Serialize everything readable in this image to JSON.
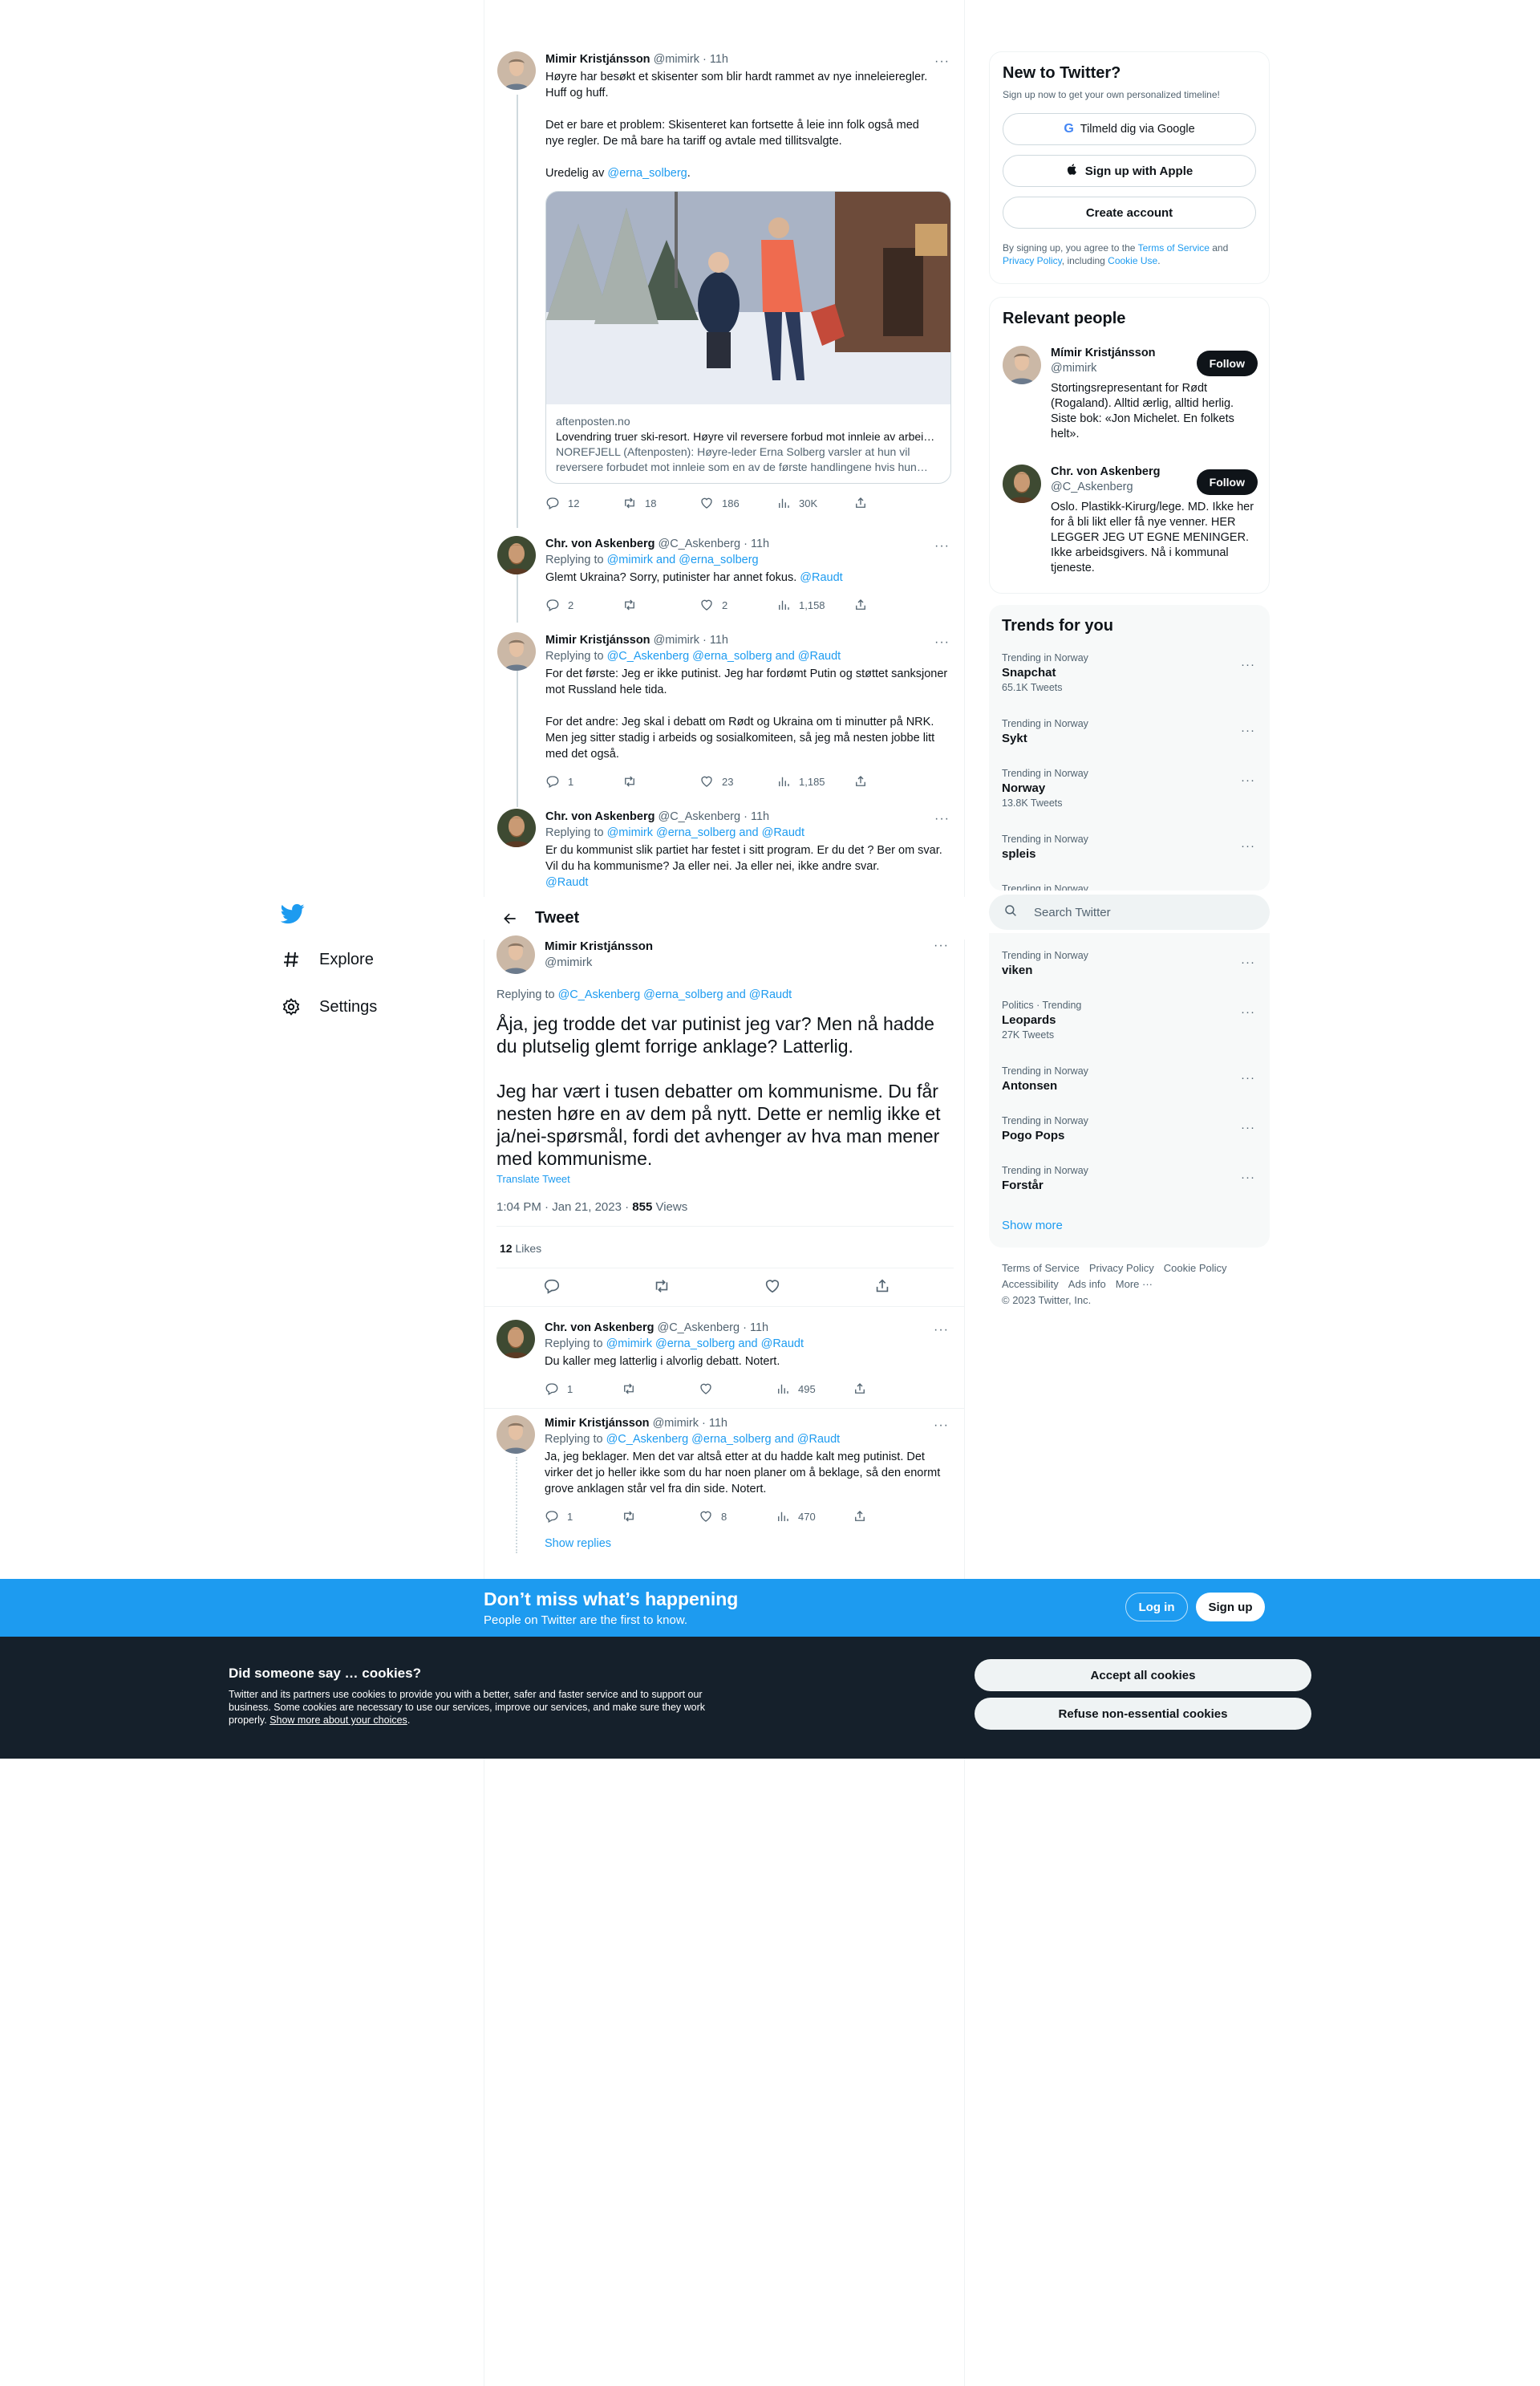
{
  "nav": {
    "explore": "Explore",
    "settings": "Settings"
  },
  "header": {
    "title": "Tweet"
  },
  "thread": [
    {
      "name": "Mimir Kristjánsson",
      "handle": "@mimirk",
      "time": "· 11h",
      "text_lines": [
        "Høyre har besøkt et skisenter som blir hardt rammet av nye inneleieregler.",
        "Huff og huff.",
        "",
        "Det er bare et problem: Skisenteret kan fortsette å leie inn folk også med",
        "nye regler. De må bare ha tariff og avtale med tillitsvalgte.",
        ""
      ],
      "text_tail": "Uredelig av ",
      "mention": "@erna_solberg",
      "text_end": ".",
      "card": {
        "domain": "aftenposten.no",
        "title": "Lovendring truer ski-resort. Høyre vil reversere forbud mot innleie av arbeidskraft",
        "description": "NOREFJELL (Aftenposten): Høyre-leder Erna Solberg varsler at hun vil reversere forbudet mot innleie som en av de første handlingene hvis hun kommer til makten igjen."
      },
      "stats": {
        "replies": "12",
        "retweets": "18",
        "likes": "186",
        "views": "30K"
      }
    },
    {
      "name": "Chr. von Askenberg",
      "handle": "@C_Askenberg",
      "time": "· 11h",
      "reply_prefix": "Replying to ",
      "reply_to": "@mimirk and @erna_solberg",
      "text": "Glemt Ukraina? Sorry, putinister har annet fokus. ",
      "text_mention": "@Raudt",
      "stats": {
        "replies": "2",
        "retweets": "",
        "likes": "2",
        "views": "1,158"
      }
    },
    {
      "name": "Mimir Kristjánsson",
      "handle": "@mimirk",
      "time": "· 11h",
      "reply_prefix": "Replying to ",
      "reply_to": "@C_Askenberg @erna_solberg and @Raudt",
      "text": "For det første: Jeg er ikke putinist. Jeg har fordømt Putin og støttet sanksjoner mot Russland hele tida.\n\nFor det andre: Jeg skal i debatt om Rødt og Ukraina om ti minutter på NRK. Men jeg sitter stadig i arbeids og sosialkomiteen, så jeg må nesten jobbe litt med det også.",
      "stats": {
        "replies": "1",
        "retweets": "",
        "likes": "23",
        "views": "1,185"
      }
    },
    {
      "name": "Chr. von Askenberg",
      "handle": "@C_Askenberg",
      "time": "· 11h",
      "reply_prefix": "Replying to ",
      "reply_to": "@mimirk @erna_solberg and @Raudt",
      "text": "Er du kommunist slik partiet har festet i sitt program. Er du det ? Ber om svar. Vil du ha kommunisme? Ja eller nei. Ja eller nei, ikke andre svar.",
      "text_mention": "@Raudt"
    }
  ],
  "focused": {
    "name": "Mimir Kristjánsson",
    "handle": "@mimirk",
    "reply_prefix": "Replying to ",
    "reply_to": "@C_Askenberg @erna_solberg and @Raudt",
    "text": "Åja, jeg trodde det var putinist jeg var? Men nå hadde du plutselig glemt forrige anklage? Latterlig.\n\nJeg har vært i tusen debatter om kommunisme. Du får nesten høre en av dem på nytt. Dette er nemlig ikke et ja/nei-spørsmål, fordi det avhenger av hva man mener med kommunisme.",
    "translate": "Translate Tweet",
    "timestamp": "1:04 PM · Jan 21, 2023 · ",
    "views_count": "855",
    "views_label": " Views",
    "likes_count": "12",
    "likes_label": " Likes"
  },
  "replies": [
    {
      "name": "Chr. von Askenberg",
      "handle": "@C_Askenberg",
      "time": "· 11h",
      "reply_prefix": "Replying to ",
      "reply_to": "@mimirk @erna_solberg and @Raudt",
      "text": "Du kaller meg latterlig i alvorlig debatt. Notert.",
      "stats": {
        "replies": "1",
        "retweets": "",
        "likes": "",
        "views": "495"
      }
    },
    {
      "name": "Mimir Kristjánsson",
      "handle": "@mimirk",
      "time": "· 11h",
      "reply_prefix": "Replying to ",
      "reply_to": "@C_Askenberg @erna_solberg and @Raudt",
      "text": "Ja, jeg beklager. Men det var altså etter at du hadde kalt meg putinist. Det virker det jo heller ikke som du har noen planer om å beklage, så den enormt grove anklagen står vel fra din side. Notert.",
      "stats": {
        "replies": "1",
        "retweets": "",
        "likes": "8",
        "views": "470"
      },
      "show_replies": "Show replies"
    }
  ],
  "signup": {
    "title": "New to Twitter?",
    "subtitle": "Sign up now to get your own personalized timeline!",
    "google": "Tilmeld dig via Google",
    "apple": "Sign up with Apple",
    "create": "Create account",
    "terms_pre": "By signing up, you agree to the ",
    "terms": "Terms of Service",
    "terms_and": " and ",
    "privacy": "Privacy Policy",
    "terms_mid": ", including ",
    "cookie": "Cookie Use",
    "terms_end": "."
  },
  "relevant": {
    "title": "Relevant people",
    "people": [
      {
        "name": "Mímir Kristjánsson",
        "handle": "@mimirk",
        "bio": "Stortingsrepresentant for Rødt (Rogaland). Alltid ærlig, alltid herlig. Siste bok: «Jon Michelet. En folkets helt».",
        "follow": "Follow"
      },
      {
        "name": "Chr. von Askenberg",
        "handle": "@C_Askenberg",
        "bio": "Oslo. Plastikk-Kirurg/lege. MD. Ikke her for å bli likt eller få nye venner. HER LEGGER JEG UT EGNE MENINGER. Ikke arbeidsgivers. Nå i kommunal tjeneste.",
        "follow": "Follow"
      }
    ]
  },
  "trends": {
    "title": "Trends for you",
    "items": [
      {
        "cat": "Trending in Norway",
        "name": "Snapchat",
        "count": "65.1K Tweets"
      },
      {
        "cat": "Trending in Norway",
        "name": "Sykt",
        "count": ""
      },
      {
        "cat": "Trending in Norway",
        "name": "Norway",
        "count": "13.8K Tweets"
      },
      {
        "cat": "Trending in Norway",
        "name": "spleis",
        "count": ""
      },
      {
        "cat": "Trending in Norway",
        "name": "viken",
        "count": ""
      },
      {
        "cat": "Politics · Trending",
        "name": "Leopards",
        "count": "27K Tweets"
      },
      {
        "cat": "Trending in Norway",
        "name": "Antonsen",
        "count": ""
      },
      {
        "cat": "Trending in Norway",
        "name": "Pogo Pops",
        "count": ""
      },
      {
        "cat": "Trending in Norway",
        "name": "Forstår",
        "count": ""
      }
    ],
    "partial_cat": "Trending in Norway",
    "show_more": "Show more"
  },
  "search": {
    "placeholder": "Search Twitter"
  },
  "footer": {
    "links": [
      "Terms of Service",
      "Privacy Policy",
      "Cookie Policy",
      "Accessibility",
      "Ads info",
      "More ···"
    ],
    "copyright": "© 2023 Twitter, Inc."
  },
  "banner": {
    "title": "Don’t miss what’s happening",
    "subtitle": "People on Twitter are the first to know.",
    "login": "Log in",
    "signup": "Sign up"
  },
  "cookies": {
    "title": "Did someone say … cookies?",
    "body": "Twitter and its partners use cookies to provide you with a better, safer and faster service and to support our business. Some cookies are necessary to use our services, improve our services, and make sure they work properly. ",
    "link": "Show more about your choices",
    "link_end": ".",
    "accept": "Accept all cookies",
    "refuse": "Refuse non-essential cookies"
  },
  "colors": {
    "accent": "#1d9bf0",
    "text": "#0f1419",
    "secondary": "#536471",
    "cookie_bg": "#15202b"
  }
}
